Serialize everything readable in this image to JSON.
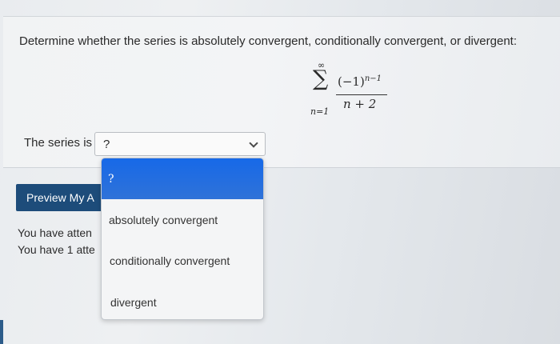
{
  "question": {
    "prompt": "Determine whether the series is absolutely convergent, conditionally convergent, or divergent:",
    "formula": {
      "upper": "∞",
      "sigma": "∑",
      "lower": "n=1",
      "numerator_base": "(−1)",
      "numerator_exp": "n−1",
      "denominator": "n + 2"
    }
  },
  "answer": {
    "label": "The series is",
    "selected_value": "?"
  },
  "dropdown": {
    "options": [
      "?",
      "absolutely convergent",
      "conditionally convergent",
      "divergent"
    ]
  },
  "actions": {
    "preview_label": "Preview My A"
  },
  "status": {
    "attempts_line1": "You have atten",
    "attempts_line2": "You have 1 atte"
  },
  "icons": {
    "select_arrow": "chevron-down-icon"
  },
  "colors": {
    "button_bg": "#1d4c7a",
    "selected_option_bg": "#1769e8"
  }
}
